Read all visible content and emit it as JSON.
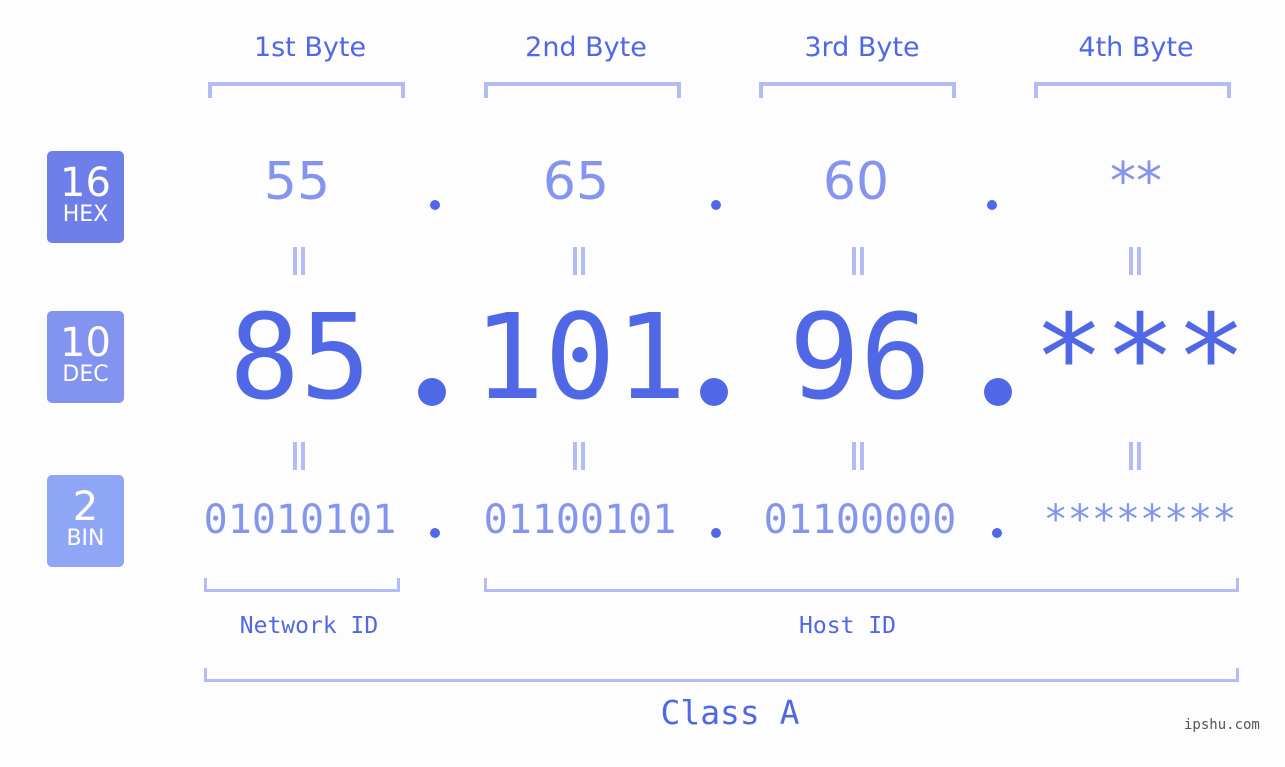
{
  "byte_headers": [
    "1st Byte",
    "2nd Byte",
    "3rd Byte",
    "4th Byte"
  ],
  "badges": [
    {
      "number": "16",
      "label": "HEX",
      "color": "#6f7fea"
    },
    {
      "number": "10",
      "label": "DEC",
      "color": "#8293f0"
    },
    {
      "number": "2",
      "label": "BIN",
      "color": "#8fa6f7"
    }
  ],
  "hex": [
    "55",
    "65",
    "60",
    "**"
  ],
  "dec": [
    "85",
    "101",
    "96",
    "***"
  ],
  "bin": [
    "01010101",
    "01100101",
    "01100000",
    "********"
  ],
  "network_id_label": "Network ID",
  "host_id_label": "Host ID",
  "class_label": "Class A",
  "watermark": "ipshu.com"
}
